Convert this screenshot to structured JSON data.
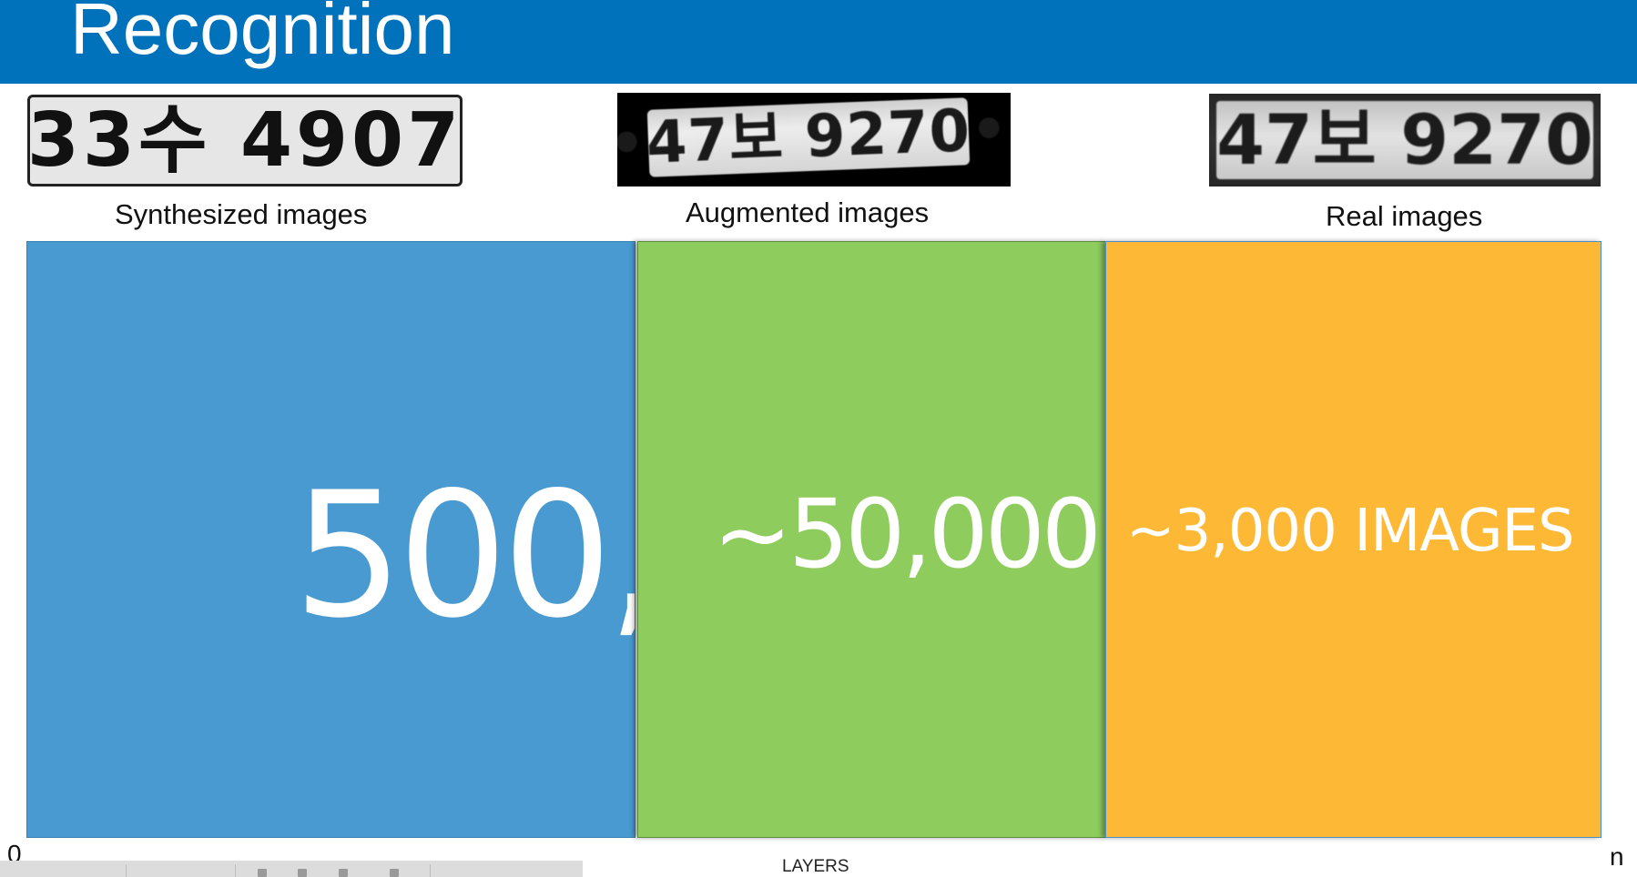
{
  "header": {
    "title": "Recognition"
  },
  "plates": {
    "synthesized": {
      "plate_text": "33수 4907",
      "caption": "Synthesized images"
    },
    "augmented": {
      "plate_text": "•47보 9270•",
      "caption": "Augmented images"
    },
    "real": {
      "plate_text": "•47보 9270•",
      "caption": "Real images"
    }
  },
  "blocks": {
    "synthesized": {
      "count_text": "500,",
      "color": "#4a9ad2"
    },
    "augmented": {
      "count_text": "~50,000",
      "color": "#8fcc5e"
    },
    "real": {
      "count_text": "~3,000 IMAGES",
      "color": "#fdb835"
    }
  },
  "axis": {
    "start_label": "0",
    "end_label": "n",
    "title": "LAYERS"
  },
  "colors": {
    "header_background": "#0072bc",
    "header_text": "#ffffff"
  }
}
